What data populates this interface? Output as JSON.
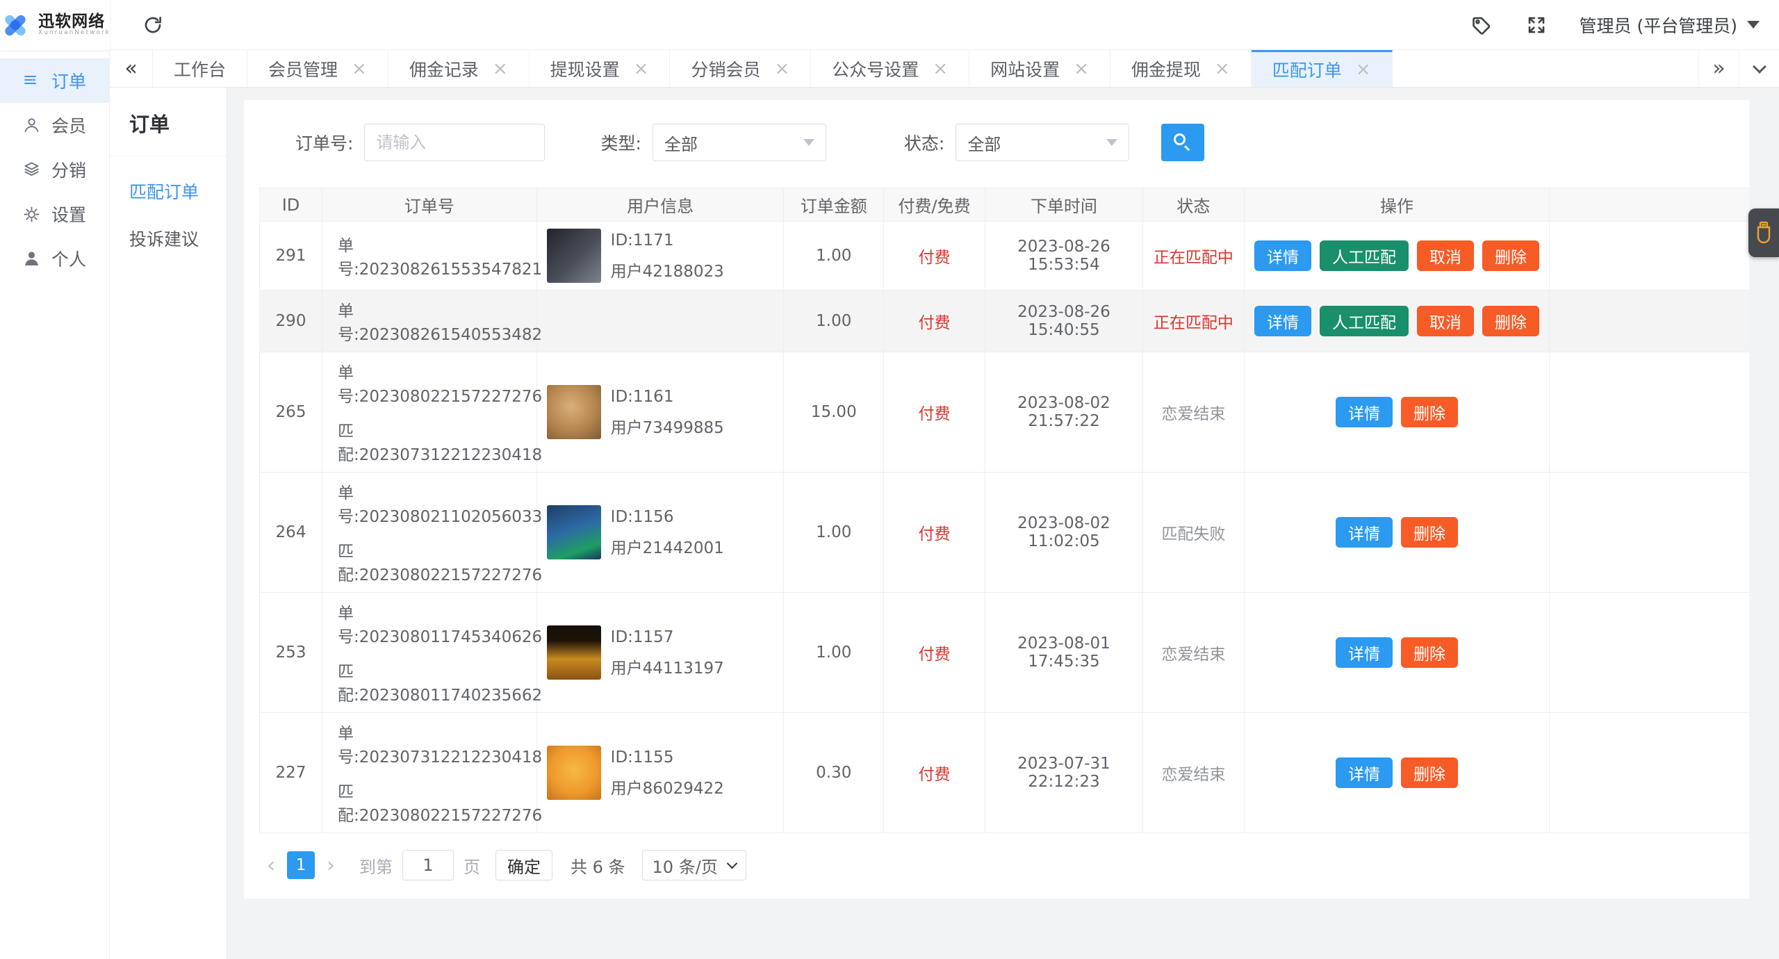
{
  "colors": {
    "accent_blue": "#3d96f0",
    "button_blue": "#2b9af0",
    "button_green": "#1a8f6b",
    "button_orange": "#f75b26",
    "status_red": "#d9372e",
    "widget_orange": "#f0a32f"
  },
  "topbar": {
    "brand": "迅软网络",
    "brand_sub": "XunruanNetwork",
    "admin_label": "管理员 (平台管理员)"
  },
  "sidebar": {
    "items": [
      {
        "key": "orders",
        "label": "订单",
        "icon": "order-list-icon",
        "active": true
      },
      {
        "key": "members",
        "label": "会员",
        "icon": "user-icon",
        "active": false
      },
      {
        "key": "distribution",
        "label": "分销",
        "icon": "layers-icon",
        "active": false
      },
      {
        "key": "settings",
        "label": "设置",
        "icon": "gear-icon",
        "active": false
      },
      {
        "key": "profile",
        "label": "个人",
        "icon": "person-icon",
        "active": false
      }
    ]
  },
  "tabs": {
    "collapse_glyph": "«",
    "more_glyph": "»",
    "close_glyph": "×",
    "items": [
      {
        "key": "workbench",
        "label": "工作台",
        "closable": false,
        "active": false
      },
      {
        "key": "member-management",
        "label": "会员管理",
        "closable": true,
        "active": false
      },
      {
        "key": "commission-records",
        "label": "佣金记录",
        "closable": true,
        "active": false
      },
      {
        "key": "withdraw-settings",
        "label": "提现设置",
        "closable": true,
        "active": false
      },
      {
        "key": "distribution-members",
        "label": "分销会员",
        "closable": true,
        "active": false
      },
      {
        "key": "official-account-settings",
        "label": "公众号设置",
        "closable": true,
        "active": false
      },
      {
        "key": "website-settings",
        "label": "网站设置",
        "closable": true,
        "active": false
      },
      {
        "key": "commission-withdraw",
        "label": "佣金提现",
        "closable": true,
        "active": false
      },
      {
        "key": "match-orders",
        "label": "匹配订单",
        "closable": true,
        "active": true
      }
    ]
  },
  "submenu": {
    "title": "订单",
    "items": [
      {
        "key": "match-orders",
        "label": "匹配订单",
        "active": true
      },
      {
        "key": "complaints",
        "label": "投诉建议",
        "active": false
      }
    ]
  },
  "filters": {
    "order_no_label": "订单号:",
    "order_no_placeholder": "请输入",
    "type_label": "类型:",
    "type_value": "全部",
    "status_label": "状态:",
    "status_value": "全部"
  },
  "table": {
    "columns": [
      "ID",
      "订单号",
      "用户信息",
      "订单金额",
      "付费/免费",
      "下单时间",
      "状态",
      "操作"
    ],
    "rows": [
      {
        "id": "291",
        "order_lines": [
          "单号:202308261553547821"
        ],
        "avatar": "female-portrait",
        "user_id": "ID:1171",
        "user_no": "用户42188023",
        "amount": "1.00",
        "pay": "付费",
        "time": "2023-08-26 15:53:54",
        "status": "正在匹配中",
        "status_color": "red",
        "striped": false,
        "actions": [
          {
            "label": "详情",
            "color": "blue"
          },
          {
            "label": "人工匹配",
            "color": "green"
          },
          {
            "label": "取消",
            "color": "orange"
          },
          {
            "label": "删除",
            "color": "orange"
          }
        ]
      },
      {
        "id": "290",
        "order_lines": [
          "单号:202308261540553482"
        ],
        "avatar": null,
        "user_id": "",
        "user_no": "",
        "amount": "1.00",
        "pay": "付费",
        "time": "2023-08-26 15:40:55",
        "status": "正在匹配中",
        "status_color": "red",
        "striped": true,
        "actions": [
          {
            "label": "详情",
            "color": "blue"
          },
          {
            "label": "人工匹配",
            "color": "green"
          },
          {
            "label": "取消",
            "color": "orange"
          },
          {
            "label": "删除",
            "color": "orange"
          }
        ]
      },
      {
        "id": "265",
        "order_lines": [
          "单号:202308022157227276",
          "匹配:202307312212230418"
        ],
        "avatar": "dog-photo",
        "user_id": "ID:1161",
        "user_no": "用户73499885",
        "amount": "15.00",
        "pay": "付费",
        "time": "2023-08-02 21:57:22",
        "status": "恋爱结束",
        "status_color": "gray",
        "striped": false,
        "actions": [
          {
            "label": "详情",
            "color": "blue"
          },
          {
            "label": "删除",
            "color": "orange"
          }
        ]
      },
      {
        "id": "264",
        "order_lines": [
          "单号:202308021102056033",
          "匹配:202308022157227276"
        ],
        "avatar": "app-screenshot",
        "user_id": "ID:1156",
        "user_no": "用户21442001",
        "amount": "1.00",
        "pay": "付费",
        "time": "2023-08-02 11:02:05",
        "status": "匹配失败",
        "status_color": "gray",
        "striped": false,
        "actions": [
          {
            "label": "详情",
            "color": "blue"
          },
          {
            "label": "删除",
            "color": "orange"
          }
        ]
      },
      {
        "id": "253",
        "order_lines": [
          "单号:202308011745340626",
          "匹配:202308011740235662"
        ],
        "avatar": "poster",
        "user_id": "ID:1157",
        "user_no": "用户44113197",
        "amount": "1.00",
        "pay": "付费",
        "time": "2023-08-01 17:45:35",
        "status": "恋爱结束",
        "status_color": "gray",
        "striped": false,
        "actions": [
          {
            "label": "详情",
            "color": "blue"
          },
          {
            "label": "删除",
            "color": "orange"
          }
        ]
      },
      {
        "id": "227",
        "order_lines": [
          "单号:202307312212230418",
          "匹配:202308022157227276"
        ],
        "avatar": "garfield-cartoon",
        "user_id": "ID:1155",
        "user_no": "用户86029422",
        "amount": "0.30",
        "pay": "付费",
        "time": "2023-07-31 22:12:23",
        "status": "恋爱结束",
        "status_color": "gray",
        "striped": false,
        "actions": [
          {
            "label": "详情",
            "color": "blue"
          },
          {
            "label": "删除",
            "color": "orange"
          }
        ]
      }
    ]
  },
  "pagination": {
    "prev_glyph": "‹",
    "next_glyph": "›",
    "current_page": "1",
    "goto_label": "到第",
    "goto_value": "1",
    "page_unit": "页",
    "confirm_label": "确定",
    "total_label": "共 6 条",
    "per_page_value": "10 条/页"
  }
}
